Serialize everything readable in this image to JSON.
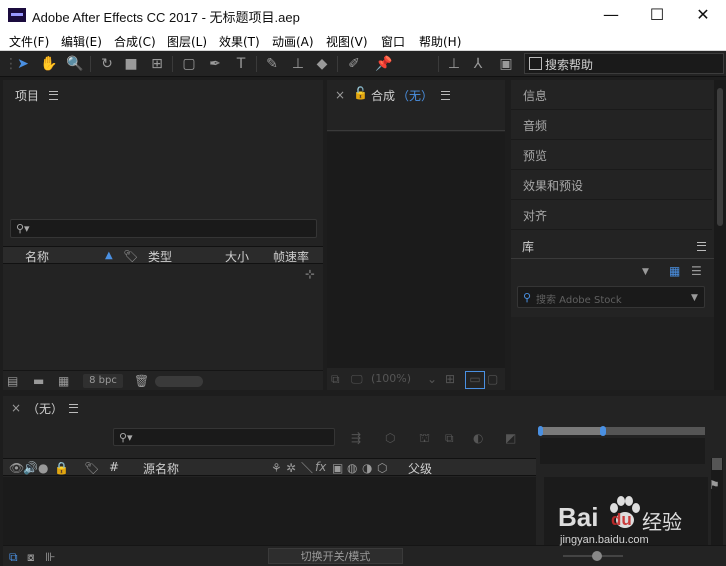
{
  "window": {
    "title": "Adobe After Effects CC 2017 - 无标题项目.aep",
    "minimize_glyph": "—",
    "maximize_glyph": "☐",
    "close_glyph": "✕"
  },
  "menu": {
    "items": [
      "文件(F)",
      "编辑(E)",
      "合成(C)",
      "图层(L)",
      "效果(T)",
      "动画(A)",
      "视图(V)",
      "窗口",
      "帮助(H)"
    ]
  },
  "toolbar": {
    "search_help": "搜索帮助"
  },
  "project_panel": {
    "title": "项目",
    "columns": {
      "name": "名称",
      "type": "类型",
      "size": "大小",
      "fps": "帧速率"
    },
    "bpc": "8 bpc"
  },
  "comp_panel": {
    "title": "合成",
    "comp_name": "（无）",
    "zoom": "(100%)"
  },
  "right_panel": {
    "items": [
      "信息",
      "音频",
      "预览",
      "效果和预设",
      "对齐"
    ],
    "library_title": "库",
    "stock_search_placeholder": "搜索 Adobe Stock"
  },
  "timeline": {
    "tab_label": "（无）",
    "columns": {
      "hash": "#",
      "source": "源名称",
      "parent": "父级"
    },
    "fx": "fx",
    "toggle_label": "切换开关/模式"
  },
  "watermark": {
    "site": "jingyan.baidu.com",
    "brand": "Bai",
    "brand2": "du",
    "jingyan": "经验"
  },
  "colors": {
    "accent": "#4a90e2",
    "panel_bg": "#232323",
    "app_bg": "#1d1d1d"
  }
}
